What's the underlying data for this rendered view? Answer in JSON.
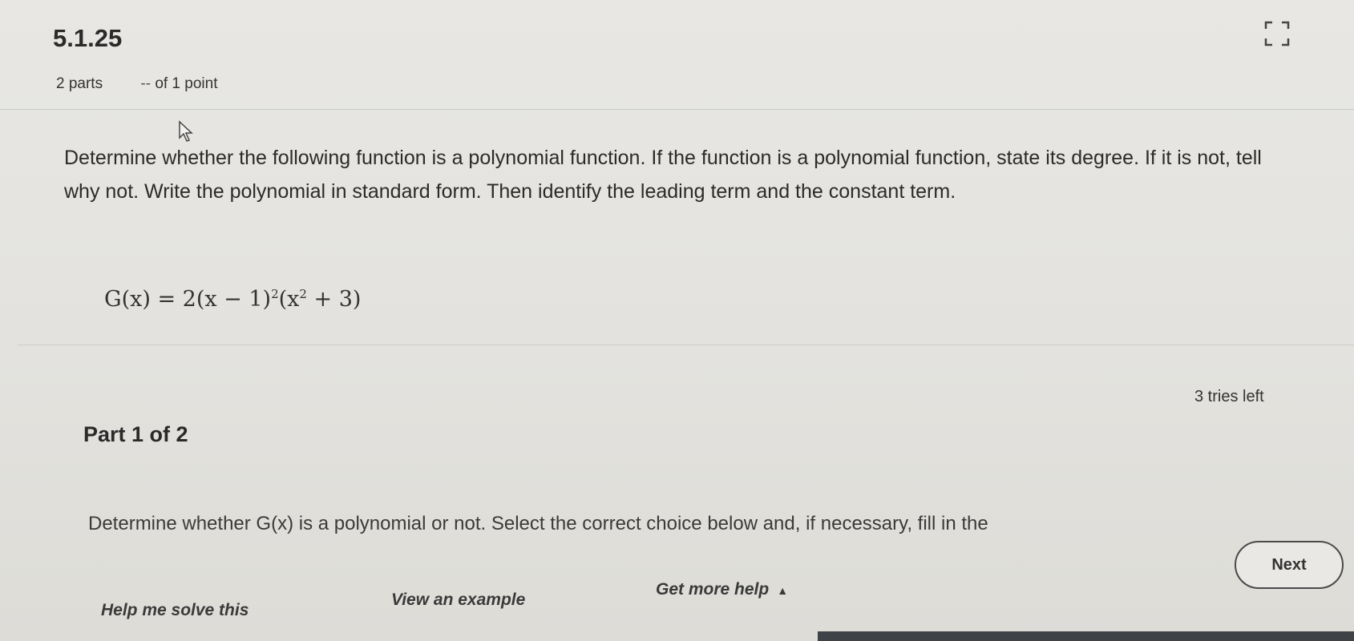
{
  "header": {
    "problem_id": "5.1.25",
    "parts": "2 parts",
    "score_separator": "--",
    "points": "of 1 point"
  },
  "question": {
    "prompt": "Determine whether the following function is a polynomial function. If the function is a polynomial function, state its degree. If it is not, tell why not. Write the polynomial in standard form. Then identify the leading term and the constant term.",
    "formula": {
      "lhs": "G(x) = 2(x − 1)",
      "exp1": "2",
      "mid": "(x",
      "exp2": "2",
      "rhs": " + 3)"
    }
  },
  "status": {
    "tries_left": "3 tries left"
  },
  "part": {
    "label": "Part 1 of 2",
    "instruction": "Determine whether G(x) is a polynomial or not. Select the correct choice below and, if necessary, fill in the"
  },
  "actions": {
    "next_label": "Next",
    "help_solve_label": "Help me solve this",
    "view_example_label": "View an example",
    "more_help_label": "Get more help",
    "more_help_caret": "▲"
  },
  "colors": {
    "background": "#e6e5e1",
    "text": "#2b2b2b",
    "bottom_bar": "#3f4247"
  },
  "icons": {
    "expand": "expand-icon",
    "cursor": "mouse-cursor-icon"
  }
}
